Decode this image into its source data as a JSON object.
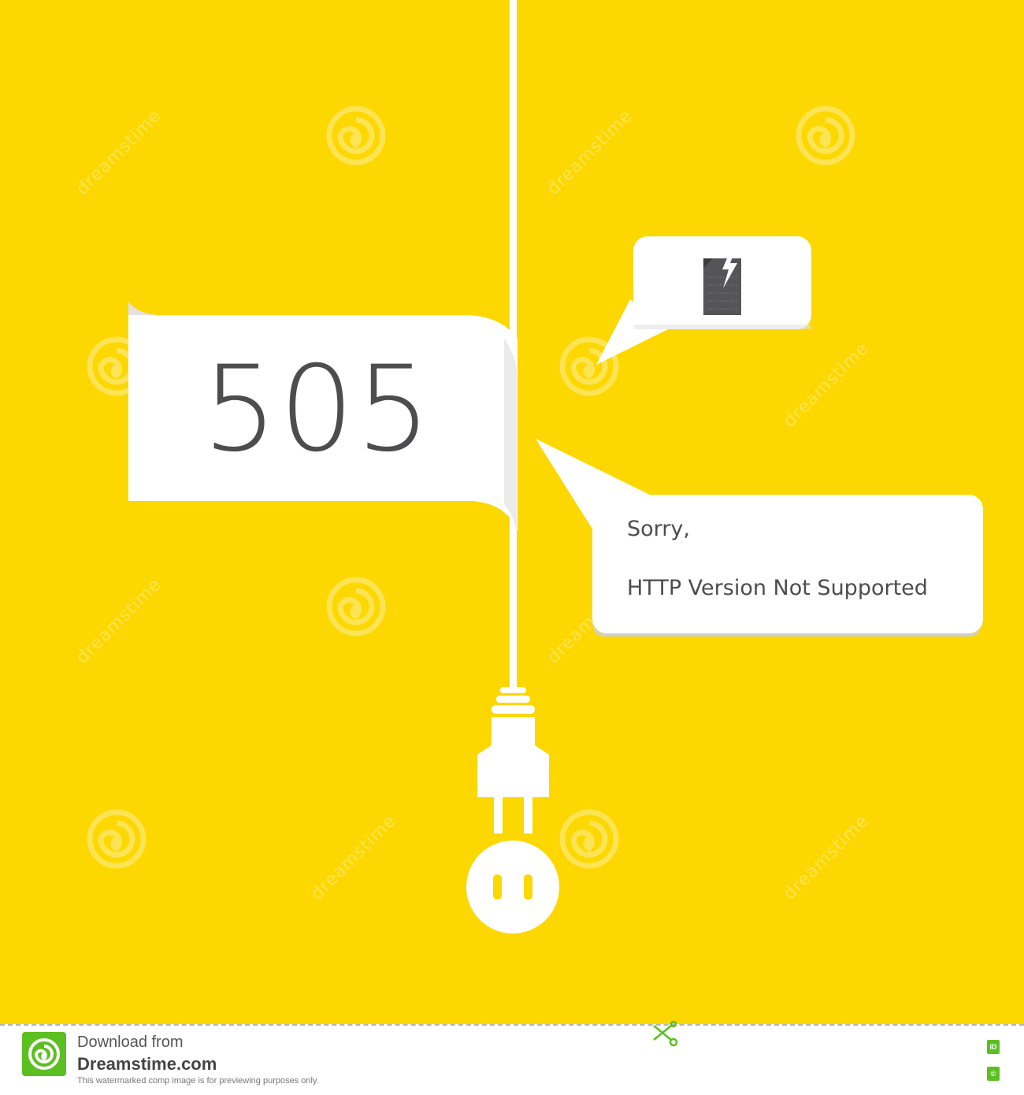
{
  "error": {
    "code": "505",
    "message_line_1": "Sorry,",
    "message_line_2": "HTTP Version Not Supported"
  },
  "icons": {
    "document": "document-with-lightning-icon",
    "plug": "power-plug-icon",
    "socket": "power-socket-icon",
    "watermark": "dreamstime-spiral-logo-icon",
    "scissors": "scissors-icon"
  },
  "watermark": {
    "text": "dreamstime"
  },
  "footer": {
    "line1": "Download from",
    "line2": "Dreamstime.com",
    "line3": "This watermarked comp image is for previewing purposes only.",
    "badge_id": "ID",
    "badge_copyright": "©"
  },
  "colors": {
    "background": "#FDD700",
    "panel": "#FFFFFF",
    "text": "#4D4D4F",
    "brand_green": "#5BBF21"
  }
}
